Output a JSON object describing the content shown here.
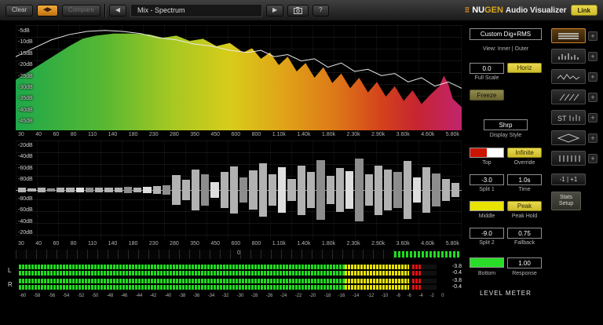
{
  "colors": {
    "accent_yellow": "#cdbd2c",
    "accent_orange": "#e08818",
    "meter_green": "#1fdc1f",
    "meter_yellow": "#e8e400",
    "meter_red": "#e01212",
    "swatch_top_left": "#cc1402",
    "swatch_top_right": "#ffffff",
    "swatch_middle": "#e8e400",
    "swatch_bottom": "#28dc28"
  },
  "icons": {
    "back_arrow": "◀",
    "play": "▶",
    "swap": "◀▶",
    "help": "?"
  },
  "topbar": {
    "clear": "Clear",
    "compare": "Compare",
    "preset": "Mix - Spectrum",
    "brand_nu": "NU",
    "brand_gen": "GEN",
    "brand_rest": "Audio Visualizer",
    "link": "Link"
  },
  "spectrum": {
    "db_labels": [
      "-5dB",
      "-10dB",
      "-15dB",
      "-20dB",
      "-25dB",
      "-30dB",
      "-35dB",
      "-40dB",
      "-45dB"
    ],
    "freq_labels": [
      "30",
      "40",
      "60",
      "80",
      "110",
      "140",
      "180",
      "230",
      "280",
      "350",
      "450",
      "600",
      "800",
      "1.10k",
      "1.40k",
      "1.80k",
      "2.30k",
      "2.90k",
      "3.60k",
      "4.60k",
      "5.80k"
    ],
    "fill_points": [
      [
        0,
        52
      ],
      [
        3,
        44
      ],
      [
        6,
        36
      ],
      [
        9,
        28
      ],
      [
        12,
        20
      ],
      [
        15,
        13
      ],
      [
        18,
        10
      ],
      [
        22,
        8
      ],
      [
        26,
        8
      ],
      [
        30,
        9
      ],
      [
        33,
        12
      ],
      [
        36,
        10
      ],
      [
        39,
        15
      ],
      [
        42,
        13
      ],
      [
        45,
        20
      ],
      [
        48,
        17
      ],
      [
        51,
        26
      ],
      [
        53,
        22
      ],
      [
        55,
        32
      ],
      [
        57,
        26
      ],
      [
        59,
        38
      ],
      [
        61,
        30
      ],
      [
        63,
        44
      ],
      [
        65,
        36
      ],
      [
        67,
        50
      ],
      [
        69,
        40
      ],
      [
        71,
        55
      ],
      [
        73,
        46
      ],
      [
        75,
        60
      ],
      [
        77,
        50
      ],
      [
        79,
        64
      ],
      [
        81,
        54
      ],
      [
        83,
        68
      ],
      [
        85,
        58
      ],
      [
        87,
        72
      ],
      [
        89,
        62
      ],
      [
        91,
        75
      ],
      [
        93,
        66
      ],
      [
        95,
        58
      ],
      [
        96,
        48
      ],
      [
        97,
        56
      ],
      [
        98,
        70
      ],
      [
        100,
        78
      ]
    ],
    "peak_line_points": [
      [
        0,
        30
      ],
      [
        4,
        22
      ],
      [
        8,
        14
      ],
      [
        12,
        9
      ],
      [
        16,
        6
      ],
      [
        20,
        5
      ],
      [
        24,
        6
      ],
      [
        28,
        8
      ],
      [
        32,
        12
      ],
      [
        36,
        14
      ],
      [
        40,
        18
      ],
      [
        44,
        20
      ],
      [
        48,
        24
      ],
      [
        52,
        26
      ],
      [
        55,
        24
      ],
      [
        58,
        30
      ],
      [
        61,
        28
      ],
      [
        64,
        34
      ],
      [
        67,
        32
      ],
      [
        70,
        40
      ],
      [
        73,
        36
      ],
      [
        76,
        44
      ],
      [
        79,
        42
      ],
      [
        82,
        48
      ],
      [
        85,
        46
      ],
      [
        88,
        54
      ],
      [
        91,
        50
      ],
      [
        94,
        58
      ],
      [
        97,
        54
      ],
      [
        100,
        60
      ]
    ]
  },
  "history": {
    "db_labels_top": [
      "-20dB",
      "-40dB",
      "-60dB",
      "-80dB"
    ],
    "db_labels_bottom": [
      "-80dB",
      "-60dB",
      "-40dB",
      "-20dB"
    ],
    "freq_labels": [
      "30",
      "40",
      "60",
      "80",
      "110",
      "140",
      "180",
      "230",
      "280",
      "350",
      "450",
      "600",
      "800",
      "1.10k",
      "1.40k",
      "1.80k",
      "2.30k",
      "2.90k",
      "3.60k",
      "4.60k",
      "5.80k"
    ],
    "bars": [
      4,
      3,
      4,
      3,
      4,
      5,
      4,
      4,
      5,
      4,
      5,
      6,
      5,
      6,
      8,
      10,
      30,
      20,
      42,
      32,
      16,
      36,
      48,
      26,
      40,
      54,
      32,
      46,
      22,
      50,
      36,
      60,
      28,
      44,
      38,
      64,
      32,
      50,
      42,
      36,
      58,
      26,
      46,
      34,
      22,
      14
    ]
  },
  "correlation": {
    "zero_label": "0",
    "bar_pct": 15
  },
  "meter": {
    "channels": [
      {
        "label": "L",
        "green_pct": 78,
        "yellow_pct": 15.5,
        "peak_left_pct": 94.2,
        "peak_width_pct": 2.2,
        "readouts": [
          "-3.8",
          "-0.4"
        ]
      },
      {
        "label": "R",
        "green_pct": 78,
        "yellow_pct": 15.5,
        "peak_left_pct": 94.2,
        "peak_width_pct": 2.2,
        "readouts": [
          "-3.8",
          "-0.4"
        ]
      }
    ],
    "scale": [
      "-60",
      "-58",
      "-56",
      "-54",
      "-52",
      "-50",
      "-48",
      "-46",
      "-44",
      "-42",
      "-40",
      "-38",
      "-36",
      "-34",
      "-32",
      "-30",
      "-28",
      "-26",
      "-24",
      "-22",
      "-20",
      "-18",
      "-16",
      "-14",
      "-12",
      "-10",
      "-8",
      "-6",
      "-4",
      "-2",
      "0"
    ]
  },
  "controls": {
    "mode_select": "Custom Dig+RMS",
    "view_label": "View: Inner | Outer",
    "full_scale_value": "0.0",
    "horiz": "Horiz",
    "full_scale_label": "Full Scale",
    "freeze": "Freeze",
    "display_style_value": "Shrp",
    "display_style_label": "Display Style",
    "infinite": "Infinite",
    "top_label": "Top",
    "override_label": "Override",
    "split1_value": "-3.0",
    "time_value": "1.0s",
    "split1_label": "Split 1",
    "time_label": "Time",
    "peak": "Peak",
    "middle_label": "Middle",
    "peak_hold_label": "Peak Hold",
    "split2_value": "-9.0",
    "fallback_value": "0.75",
    "split2_label": "Split 2",
    "fallback_label": "Fallback",
    "response_value": "1.00",
    "bottom_label": "Bottom",
    "response_label": "Response",
    "level_meter_title": "LEVEL METER"
  },
  "modebar": {
    "plus_label": "+",
    "pm_label": "-1 | +1",
    "stats_line1": "Stats",
    "stats_line2": "Setup"
  }
}
